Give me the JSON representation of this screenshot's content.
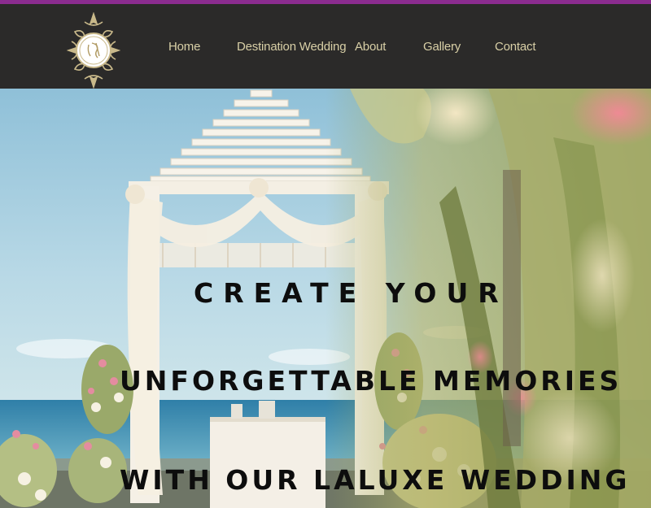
{
  "header": {
    "accent_color": "#8b2c8f",
    "background_color": "#2b2a29",
    "logo": {
      "icon": "ornamental-monogram-logo"
    },
    "nav": [
      {
        "label": "Home"
      },
      {
        "label": "Destination Wedding"
      },
      {
        "label": "About"
      },
      {
        "label": "Gallery"
      },
      {
        "label": "Contact"
      }
    ],
    "nav_color": "#d8cfa6"
  },
  "hero": {
    "image": "beach-wedding-gazebo-photo",
    "headline": {
      "line1": "CREATE YOUR",
      "line2": "UNFORGETTABLE MEMORIES",
      "line3": "WITH OUR LALUXE WEDDING"
    }
  }
}
